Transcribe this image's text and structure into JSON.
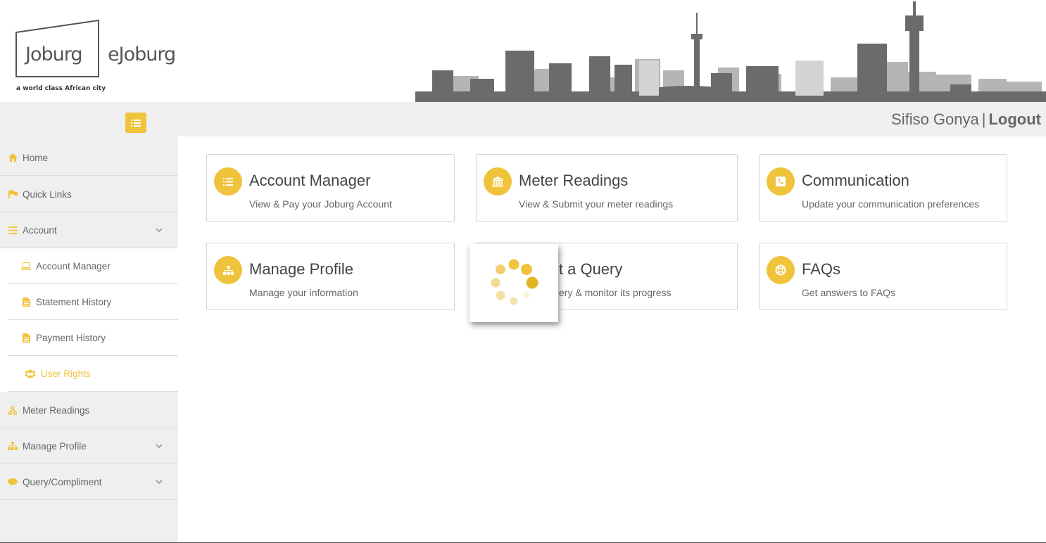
{
  "header": {
    "logo_text": "Joburg",
    "ejoburg_text": "eJoburg",
    "tagline": "a world class African city"
  },
  "topbar": {
    "user_name": "Sifiso Gonya",
    "separator": "|",
    "logout_label": "Logout"
  },
  "sidebar": {
    "items": [
      {
        "label": "Home",
        "icon": "home-icon"
      },
      {
        "label": "Quick Links",
        "icon": "flag-icon"
      },
      {
        "label": "Account",
        "icon": "list-icon"
      },
      {
        "label": "Meter Readings",
        "icon": "sitemap-icon"
      },
      {
        "label": "Manage Profile",
        "icon": "sitemap-icon"
      },
      {
        "label": "Query/Compliment",
        "icon": "comment-icon"
      }
    ],
    "account_sub": [
      {
        "label": "Account Manager",
        "icon": "laptop-icon"
      },
      {
        "label": "Statement History",
        "icon": "file-icon"
      },
      {
        "label": "Payment History",
        "icon": "file-icon"
      },
      {
        "label": "User Rights",
        "icon": "users-icon"
      }
    ]
  },
  "cards": [
    {
      "title": "Account Manager",
      "desc": "View & Pay your Joburg Account",
      "icon": "list-icon"
    },
    {
      "title": "Meter Readings",
      "desc": "View & Submit your meter readings",
      "icon": "bank-icon"
    },
    {
      "title": "Communication",
      "desc": "Update your communication preferences",
      "icon": "phone-icon"
    },
    {
      "title": "Manage Profile",
      "desc": "Manage your information",
      "icon": "sitemap-icon"
    },
    {
      "title": "it a Query",
      "desc": "ery & monitor its progress",
      "icon": "query-icon"
    },
    {
      "title": "FAQs",
      "desc": "Get answers to FAQs",
      "icon": "lifebuoy-icon"
    }
  ],
  "colors": {
    "accent": "#f0c33c",
    "sidebar_bg": "#efefef",
    "text": "#666666"
  }
}
